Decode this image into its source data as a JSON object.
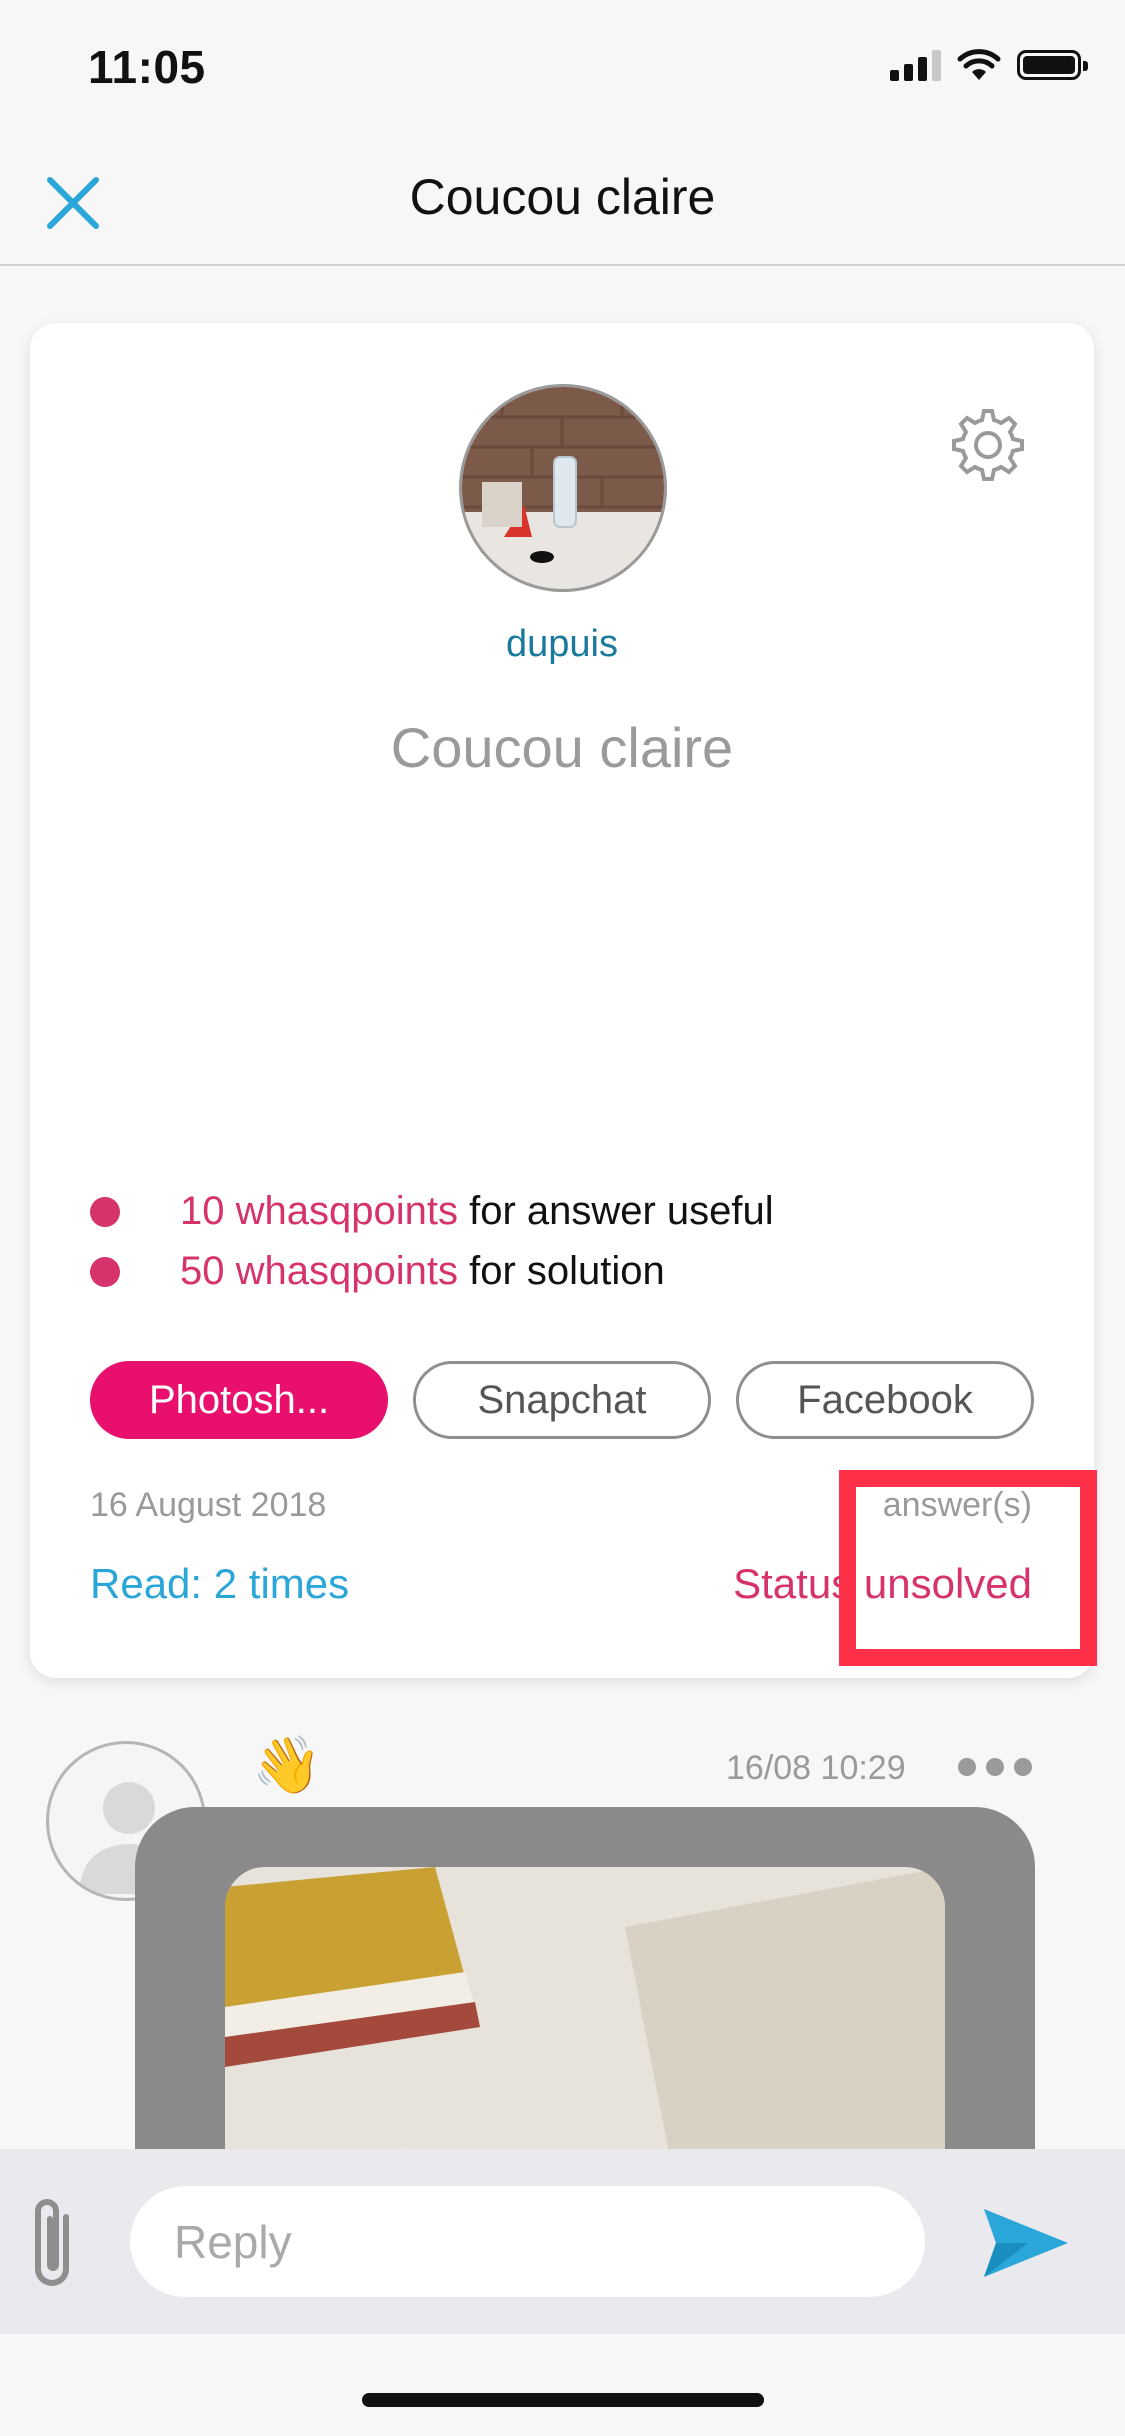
{
  "status_bar": {
    "time": "11:05"
  },
  "nav": {
    "title": "Coucou claire"
  },
  "post": {
    "username": "dupuis",
    "title": "Coucou claire",
    "rewards": [
      {
        "points": "10 whasqpoints",
        "label": " for answer useful"
      },
      {
        "points": "50 whasqpoints",
        "label": " for solution"
      }
    ],
    "tags": [
      "Photosh...",
      "Snapchat",
      "Facebook"
    ],
    "date": "16 August 2018",
    "answers": "answer(s)",
    "reads": "Read: 2 times",
    "status": "Status unsolved"
  },
  "message": {
    "emoji": "👋",
    "time": "16/08 10:29"
  },
  "reply": {
    "placeholder": "Reply"
  },
  "colors": {
    "accent_blue": "#2aa6d9",
    "accent_pink": "#d6336c",
    "tag_active": "#e8106c",
    "highlight": "#ff3148"
  }
}
